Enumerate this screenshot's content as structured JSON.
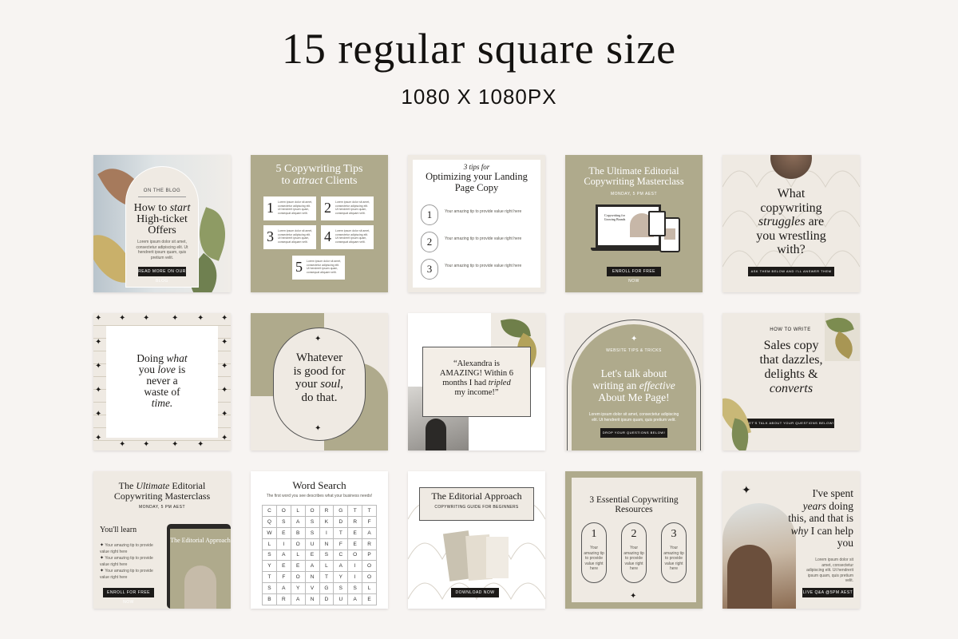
{
  "header": {
    "title": "15 regular square size",
    "subtitle": "1080 X 1080PX"
  },
  "colors": {
    "olive": "#afaa8c",
    "cream": "#efeae3",
    "dark": "#1c1a18",
    "bg": "#f7f4f2"
  },
  "cards": {
    "c1": {
      "kicker": "ON THE BLOG",
      "title1": "How to ",
      "title_em": "start",
      "title2": "High-ticket Offers",
      "body": "Lorem ipsum dolor sit amet, consectetur adipiscing elit. Ut hendrerit ipsum quam, quis pretium velit.",
      "button": "READ MORE ON OUR BLOG"
    },
    "c2": {
      "title1": "5 Copywriting Tips",
      "title2a": "to ",
      "title2_em": "attract",
      "title2b": " Clients",
      "tip_text": "Lorem ipsum dolor sit amet, consectetur adipiscing elit. Ut hendrerit ipsum quam, consequat aliquam velit.",
      "nums": [
        "1",
        "2",
        "3",
        "4",
        "5"
      ]
    },
    "c3": {
      "kicker": "3 tips for",
      "title": "Optimizing your Landing Page Copy",
      "tip": "Your amazing tip to provide value right here",
      "nums": [
        "1",
        "2",
        "3"
      ]
    },
    "c4": {
      "title": "The Ultimate Editorial Copywriting Masterclass",
      "date": "MONDAY, 5 PM AEST",
      "button": "ENROLL FOR FREE NOW",
      "screen_title": "Copywriting for Growing Brands"
    },
    "c5": {
      "line1": "What",
      "line2": "copywriting",
      "line3_em": "struggles",
      "line3b": " are",
      "line4": "you wrestling",
      "line5": "with?",
      "button": "ASK THEM BELOW AND I'LL ANSWER THEM"
    },
    "c6": {
      "line1": "Doing ",
      "line1_em": "what",
      "line2": "you ",
      "line2_em": "love",
      "line2b": " is",
      "line3": "never a",
      "line4": "waste of",
      "line5_em": "time."
    },
    "c7": {
      "line1": "Whatever",
      "line2": "is good for",
      "line3": "your ",
      "line3_em": "soul",
      "line3b": ",",
      "line4": "do that."
    },
    "c8": {
      "line1": "“Alexandra is",
      "line2": "AMAZING! Within 6",
      "line3": "months I had ",
      "line3_em": "tripled",
      "line4": "my income!”"
    },
    "c9": {
      "kicker": "WEBSITE TIPS & TRICKS",
      "line1": "Let's talk about",
      "line2": "writing an ",
      "line2_em": "effective",
      "line3": "About Me Page!",
      "body": "Lorem ipsum dolor sit amet, consectetur adipiscing elit. Ut hendrerit ipsum quam, quis pretium velit.",
      "button": "DROP YOUR QUESTIONS BELOW!"
    },
    "c10": {
      "kicker": "HOW TO WRITE",
      "line1": "Sales copy",
      "line2": "that dazzles,",
      "line3": "delights &",
      "line4_em": "converts",
      "button": "LET'S TALK ABOUT YOUR QUESTIONS BELOW!"
    },
    "c11": {
      "title1": "The ",
      "title_em": "Ultimate",
      "title2": " Editorial",
      "title3": "Copywriting Masterclass",
      "date": "MONDAY, 5 PM AEST",
      "learn": "You'll learn",
      "tips": [
        "Your amazing tip to provide value right here",
        "Your amazing tip to provide value right here",
        "Your amazing tip to provide value right here"
      ],
      "tablet_title": "The Editorial Approach",
      "button": "ENROLL FOR FREE NOW"
    },
    "c12": {
      "title": "Word Search",
      "sub": "The first word you see describes what your business needs!",
      "grid": [
        [
          "C",
          "O",
          "L",
          "O",
          "R",
          "G",
          "T",
          "T"
        ],
        [
          "Q",
          "S",
          "A",
          "S",
          "K",
          "D",
          "R",
          "F"
        ],
        [
          "W",
          "E",
          "B",
          "S",
          "I",
          "T",
          "E",
          "A"
        ],
        [
          "L",
          "I",
          "O",
          "U",
          "N",
          "F",
          "E",
          "R"
        ],
        [
          "S",
          "A",
          "L",
          "E",
          "S",
          "C",
          "O",
          "P"
        ],
        [
          "Y",
          "E",
          "E",
          "A",
          "L",
          "A",
          "I",
          "O"
        ],
        [
          "T",
          "F",
          "O",
          "N",
          "T",
          "Y",
          "I",
          "O"
        ],
        [
          "S",
          "A",
          "Y",
          "V",
          "G",
          "S",
          "S",
          "L"
        ],
        [
          "B",
          "R",
          "A",
          "N",
          "D",
          "U",
          "A",
          "E"
        ]
      ]
    },
    "c13": {
      "title": "The Editorial Approach",
      "sub": "COPYWRITING GUIDE FOR BEGINNERS",
      "button": "DOWNLOAD NOW"
    },
    "c14": {
      "title1": "3 Essential Copywriting",
      "title2": "Resources",
      "nums": [
        "1",
        "2",
        "3"
      ],
      "tip": "Your amazing tip to provide value right here"
    },
    "c15": {
      "line1": "I've spent",
      "line2_em": "years",
      "line2b": " doing",
      "line3": "this, and that is",
      "line4_em": "why",
      "line4b": " I can help",
      "line5": "you",
      "body": "Lorem ipsum dolor sit amet, consectetur adipiscing elit. Ut hendrerit ipsum quam, quis pretium velit.",
      "button": "LIVE Q&A @5PM AEST"
    }
  }
}
